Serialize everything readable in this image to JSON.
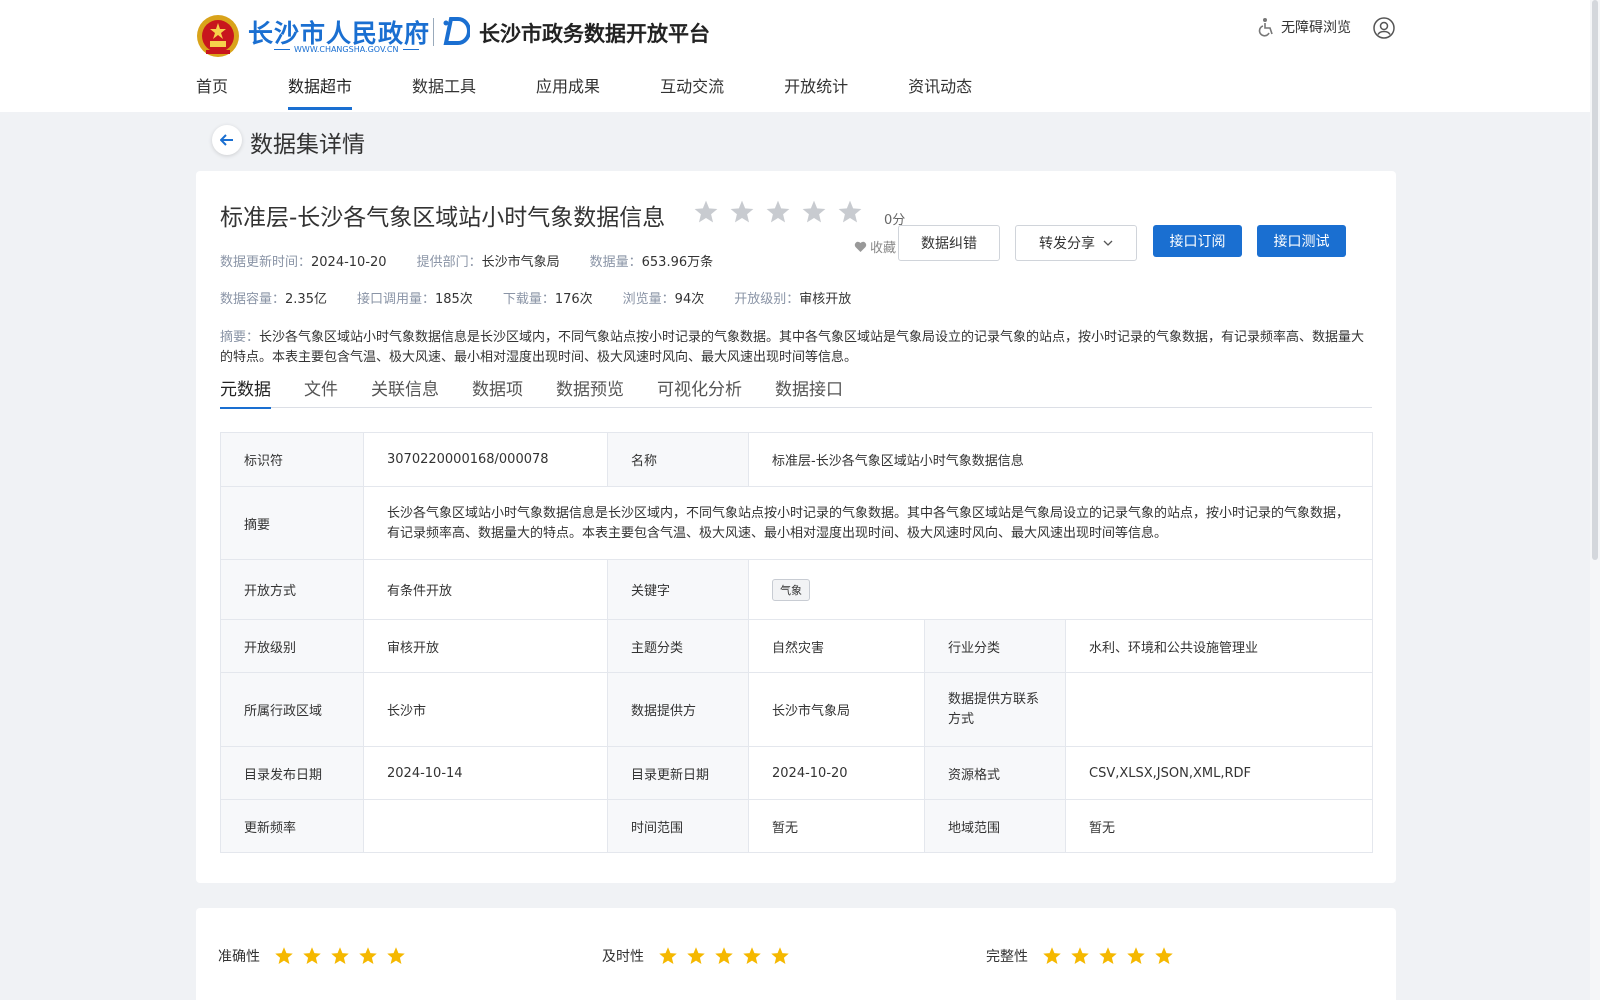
{
  "header": {
    "gov_name": "长沙市人民政府",
    "gov_url": "WWW.CHANGSHA.GOV.CN",
    "platform_title": "长沙市政务数据开放平台",
    "accessibility_label": "无障碍浏览",
    "nav": [
      {
        "label": "首页",
        "active": false
      },
      {
        "label": "数据超市",
        "active": true
      },
      {
        "label": "数据工具",
        "active": false
      },
      {
        "label": "应用成果",
        "active": false
      },
      {
        "label": "互动交流",
        "active": false
      },
      {
        "label": "开放统计",
        "active": false
      },
      {
        "label": "资讯动态",
        "active": false
      }
    ],
    "brand_color": "#1a6fd1"
  },
  "page_title": "数据集详情",
  "dataset": {
    "title": "标准层-长沙各气象区域站小时气象数据信息",
    "rating_value": 0,
    "score_label": "0分",
    "favorite_label": "收藏",
    "buttons": {
      "correct": "数据纠错",
      "share": "转发分享",
      "subscribe": "接口订阅",
      "test": "接口测试"
    },
    "meta_row1": [
      {
        "key": "数据更新时间：",
        "value": "2024-10-20"
      },
      {
        "key": "提供部门：",
        "value": "长沙市气象局"
      },
      {
        "key": "数据量：",
        "value": "653.96万条"
      }
    ],
    "meta_row2": [
      {
        "key": "数据容量：",
        "value": "2.35亿"
      },
      {
        "key": "接口调用量：",
        "value": "185次"
      },
      {
        "key": "下载量：",
        "value": "176次"
      },
      {
        "key": "浏览量：",
        "value": "94次"
      },
      {
        "key": "开放级别：",
        "value": "审核开放"
      }
    ],
    "abstract_key": "摘要：",
    "abstract_text": "长沙各气象区域站小时气象数据信息是长沙区域内，不同气象站点按小时记录的气象数据。其中各气象区域站是气象局设立的记录气象的站点，按小时记录的气象数据，有记录频率高、数据量大的特点。本表主要包含气温、极大风速、最小相对湿度出现时间、极大风速时风向、最大风速出现时间等信息。"
  },
  "tabs": [
    {
      "label": "元数据",
      "active": true
    },
    {
      "label": "文件",
      "active": false
    },
    {
      "label": "关联信息",
      "active": false
    },
    {
      "label": "数据项",
      "active": false
    },
    {
      "label": "数据预览",
      "active": false
    },
    {
      "label": "可视化分析",
      "active": false
    },
    {
      "label": "数据接口",
      "active": false
    }
  ],
  "metadata": {
    "identifier_label": "标识符",
    "identifier": "3070220000168/000078",
    "name_label": "名称",
    "name": "标准层-长沙各气象区域站小时气象数据信息",
    "abstract_label": "摘要",
    "abstract": "长沙各气象区域站小时气象数据信息是长沙区域内，不同气象站点按小时记录的气象数据。其中各气象区域站是气象局设立的记录气象的站点，按小时记录的气象数据，有记录频率高、数据量大的特点。本表主要包含气温、极大风速、最小相对湿度出现时间、极大风速时风向、最大风速出现时间等信息。",
    "open_mode_label": "开放方式",
    "open_mode": "有条件开放",
    "keyword_label": "关键字",
    "keyword": "气象",
    "open_level_label": "开放级别",
    "open_level": "审核开放",
    "theme_label": "主题分类",
    "theme": "自然灾害",
    "industry_label": "行业分类",
    "industry": "水利、环境和公共设施管理业",
    "region_label": "所属行政区域",
    "region": "长沙市",
    "provider_label": "数据提供方",
    "provider": "长沙市气象局",
    "contact_label": "数据提供方联系方式",
    "contact": "",
    "publish_date_label": "目录发布日期",
    "publish_date": "2024-10-14",
    "update_date_label": "目录更新日期",
    "update_date": "2024-10-20",
    "format_label": "资源格式",
    "format": "CSV,XLSX,JSON,XML,RDF",
    "frequency_label": "更新频率",
    "frequency": "",
    "time_range_label": "时间范围",
    "time_range": "暂无",
    "geo_range_label": "地域范围",
    "geo_range": "暂无"
  },
  "quality": [
    {
      "label": "准确性",
      "stars": 5
    },
    {
      "label": "及时性",
      "stars": 5
    },
    {
      "label": "完整性",
      "stars": 5
    }
  ],
  "colors": {
    "star_on": "#f5b800",
    "star_off": "#c8cbd0",
    "primary": "#1a6fd1"
  }
}
